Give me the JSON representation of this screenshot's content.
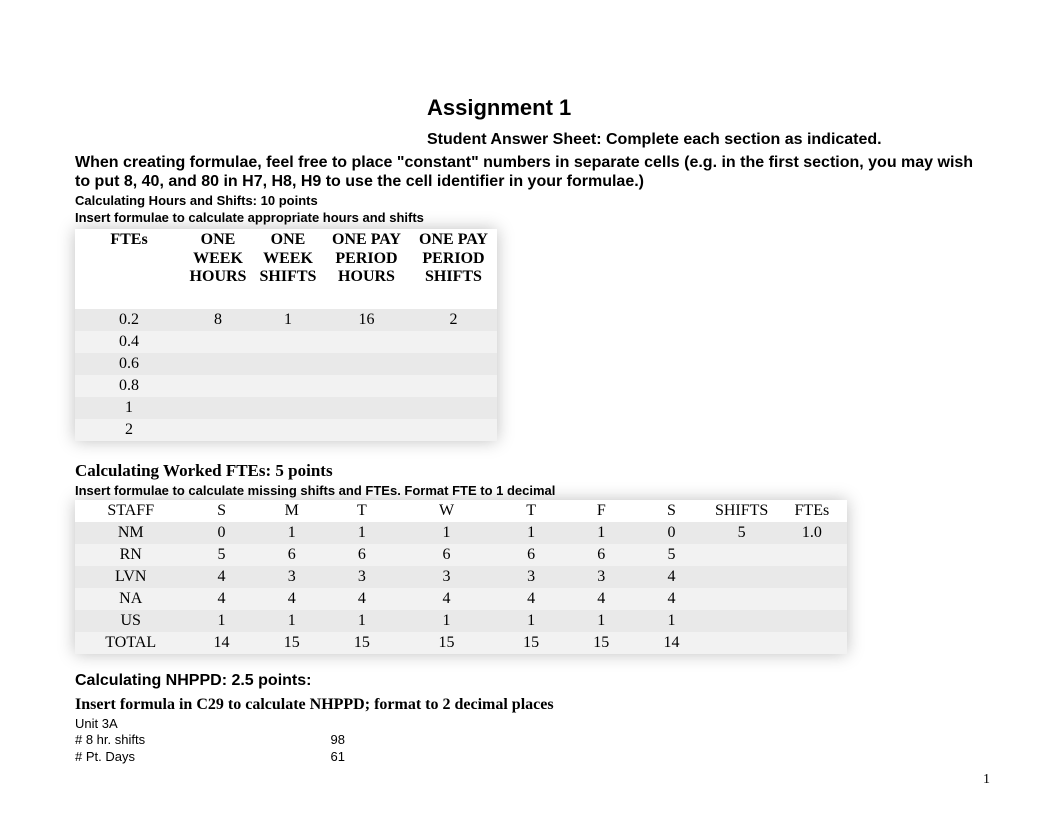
{
  "doc": {
    "title": "Assignment 1",
    "subtitle": "Student Answer Sheet: Complete each section as indicated.",
    "instructions": "When creating formulae, feel free to place \"constant\" numbers in separate cells (e.g. in the first section, you may wish to put 8, 40, and 80 in H7, H8, H9 to use the cell identifier in your formulae.)",
    "page_number": "1"
  },
  "section1": {
    "title": "Calculating Hours and Shifts: 10 points",
    "instr": "Insert formulae to calculate appropriate hours and shifts",
    "headers": [
      "FTEs",
      "ONE WEEK HOURS",
      "ONE WEEK SHIFTS",
      "ONE PAY PERIOD HOURS",
      "ONE PAY PERIOD SHIFTS"
    ],
    "rows": [
      {
        "fte": "0.2",
        "owh": "8",
        "ows": "1",
        "opph": "16",
        "opps": "2"
      },
      {
        "fte": "0.4",
        "owh": "",
        "ows": "",
        "opph": "",
        "opps": ""
      },
      {
        "fte": "0.6",
        "owh": "",
        "ows": "",
        "opph": "",
        "opps": ""
      },
      {
        "fte": "0.8",
        "owh": "",
        "ows": "",
        "opph": "",
        "opps": ""
      },
      {
        "fte": "1",
        "owh": "",
        "ows": "",
        "opph": "",
        "opps": ""
      },
      {
        "fte": "2",
        "owh": "",
        "ows": "",
        "opph": "",
        "opps": ""
      }
    ]
  },
  "section2": {
    "title": "Calculating Worked FTEs: 5 points",
    "instr": "Insert formulae to calculate missing shifts and FTEs. Format FTE to 1 decimal",
    "headers": [
      "STAFF",
      "S",
      "M",
      "T",
      "W",
      "T",
      "F",
      "S",
      "SHIFTS",
      "FTEs"
    ],
    "rows": [
      {
        "staff": "NM",
        "d": [
          "0",
          "1",
          "1",
          "1",
          "1",
          "1",
          "0"
        ],
        "shifts": "5",
        "ftes": "1.0"
      },
      {
        "staff": "RN",
        "d": [
          "5",
          "6",
          "6",
          "6",
          "6",
          "6",
          "5"
        ],
        "shifts": "",
        "ftes": ""
      },
      {
        "staff": "LVN",
        "d": [
          "4",
          "3",
          "3",
          "3",
          "3",
          "3",
          "4"
        ],
        "shifts": "",
        "ftes": ""
      },
      {
        "staff": "NA",
        "d": [
          "4",
          "4",
          "4",
          "4",
          "4",
          "4",
          "4"
        ],
        "shifts": "",
        "ftes": ""
      },
      {
        "staff": "US",
        "d": [
          "1",
          "1",
          "1",
          "1",
          "1",
          "1",
          "1"
        ],
        "shifts": "",
        "ftes": ""
      },
      {
        "staff": "TOTAL",
        "d": [
          "14",
          "15",
          "15",
          "15",
          "15",
          "15",
          "14"
        ],
        "shifts": "",
        "ftes": ""
      }
    ]
  },
  "section3": {
    "title": "Calculating NHPPD: 2.5 points:",
    "instr": "Insert formula in C29 to calculate NHPPD; format to 2 decimal places",
    "unit": "Unit 3A",
    "line1_label": "# 8 hr. shifts",
    "line1_value": "98",
    "line2_label": "# Pt. Days",
    "line2_value": "61"
  }
}
